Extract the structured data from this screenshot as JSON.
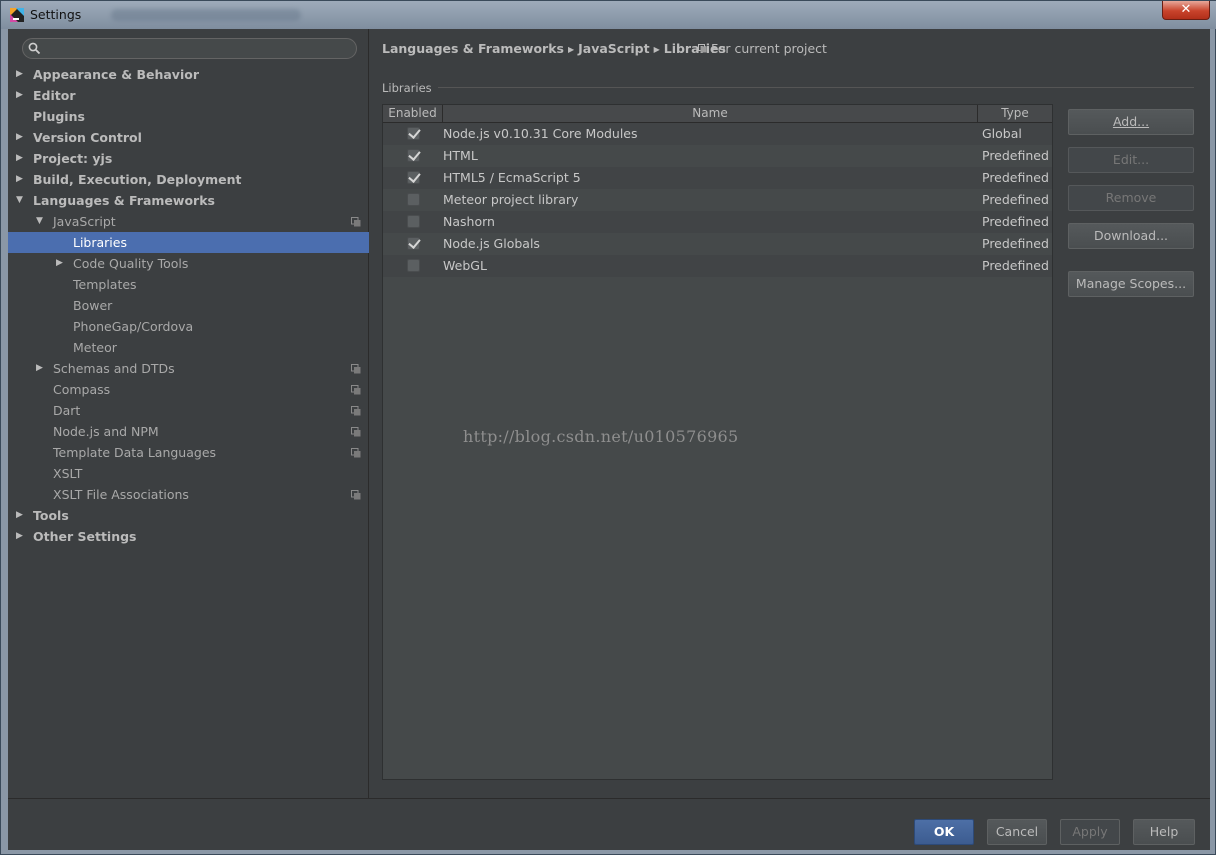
{
  "window": {
    "title": "Settings",
    "close_symbol": "✕"
  },
  "search": {
    "placeholder": ""
  },
  "tree": [
    {
      "label": "Appearance & Behavior",
      "arrow": "▶",
      "level": 0,
      "bold": true
    },
    {
      "label": "Editor",
      "arrow": "▶",
      "level": 0,
      "bold": true
    },
    {
      "label": "Plugins",
      "arrow": "",
      "level": 0,
      "bold": true
    },
    {
      "label": "Version Control",
      "arrow": "▶",
      "level": 0,
      "bold": true
    },
    {
      "label": "Project: yjs",
      "arrow": "▶",
      "level": 0,
      "bold": true
    },
    {
      "label": "Build, Execution, Deployment",
      "arrow": "▶",
      "level": 0,
      "bold": true
    },
    {
      "label": "Languages & Frameworks",
      "arrow": "▼",
      "level": 0,
      "bold": true
    },
    {
      "label": "JavaScript",
      "arrow": "▼",
      "level": 1,
      "icon": true
    },
    {
      "label": "Libraries",
      "arrow": "",
      "level": 2,
      "selected": true
    },
    {
      "label": "Code Quality Tools",
      "arrow": "▶",
      "level": 2
    },
    {
      "label": "Templates",
      "arrow": "",
      "level": 2
    },
    {
      "label": "Bower",
      "arrow": "",
      "level": 2
    },
    {
      "label": "PhoneGap/Cordova",
      "arrow": "",
      "level": 2
    },
    {
      "label": "Meteor",
      "arrow": "",
      "level": 2
    },
    {
      "label": "Schemas and DTDs",
      "arrow": "▶",
      "level": 1,
      "icon": true
    },
    {
      "label": "Compass",
      "arrow": "",
      "level": 1,
      "icon": true
    },
    {
      "label": "Dart",
      "arrow": "",
      "level": 1,
      "icon": true
    },
    {
      "label": "Node.js and NPM",
      "arrow": "",
      "level": 1,
      "icon": true
    },
    {
      "label": "Template Data Languages",
      "arrow": "",
      "level": 1,
      "icon": true
    },
    {
      "label": "XSLT",
      "arrow": "",
      "level": 1
    },
    {
      "label": "XSLT File Associations",
      "arrow": "",
      "level": 1,
      "icon": true
    },
    {
      "label": "Tools",
      "arrow": "▶",
      "level": 0,
      "bold": true
    },
    {
      "label": "Other Settings",
      "arrow": "▶",
      "level": 0,
      "bold": true
    }
  ],
  "breadcrumb": {
    "items": [
      "Languages & Frameworks",
      "JavaScript",
      "Libraries"
    ],
    "separator": "▶",
    "scope_note": "For current project"
  },
  "libraries": {
    "section_label": "Libraries",
    "columns": [
      "Enabled",
      "Name",
      "Type"
    ],
    "rows": [
      {
        "enabled": true,
        "name": "Node.js v0.10.31 Core Modules",
        "type": "Global"
      },
      {
        "enabled": true,
        "name": "HTML",
        "type": "Predefined"
      },
      {
        "enabled": true,
        "name": "HTML5 / EcmaScript 5",
        "type": "Predefined"
      },
      {
        "enabled": false,
        "name": "Meteor project library",
        "type": "Predefined"
      },
      {
        "enabled": false,
        "name": "Nashorn",
        "type": "Predefined"
      },
      {
        "enabled": true,
        "name": "Node.js Globals",
        "type": "Predefined"
      },
      {
        "enabled": false,
        "name": "WebGL",
        "type": "Predefined"
      }
    ]
  },
  "side_buttons": {
    "add": "Add...",
    "edit": "Edit...",
    "remove": "Remove",
    "download": "Download...",
    "manage_scopes": "Manage Scopes..."
  },
  "watermark": "http://blog.csdn.net/u010576965",
  "dialog_buttons": {
    "ok": "OK",
    "cancel": "Cancel",
    "apply": "Apply",
    "help": "Help"
  },
  "colors": {
    "selection": "#4b6eaf",
    "background": "#3c3f41",
    "ok_button": "#4469a0"
  }
}
